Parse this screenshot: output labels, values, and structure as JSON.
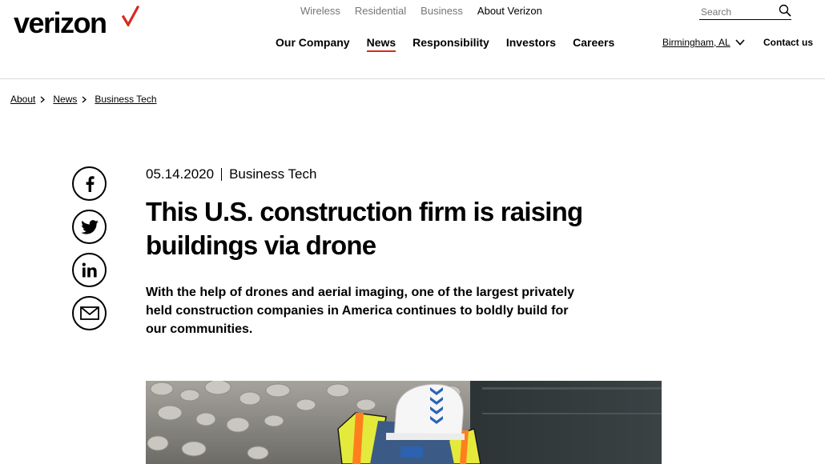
{
  "brand": {
    "logo_text": "verizon",
    "accent_color": "#d52b1e"
  },
  "utility_nav": [
    {
      "label": "Wireless"
    },
    {
      "label": "Residential"
    },
    {
      "label": "Business"
    },
    {
      "label": "About Verizon"
    }
  ],
  "search": {
    "placeholder": "Search",
    "icon": "search-icon"
  },
  "main_nav": [
    {
      "label": "Our Company"
    },
    {
      "label": "News"
    },
    {
      "label": "Responsibility"
    },
    {
      "label": "Investors"
    },
    {
      "label": "Careers"
    }
  ],
  "location": {
    "label": "Birmingham, AL",
    "icon": "chevron-down-icon"
  },
  "contact": {
    "label": "Contact us"
  },
  "breadcrumb": [
    {
      "label": "About"
    },
    {
      "label": "News"
    },
    {
      "label": "Business Tech"
    }
  ],
  "social": [
    "facebook-icon",
    "twitter-icon",
    "linkedin-icon",
    "email-icon"
  ],
  "article": {
    "date": "05.14.2020",
    "category": "Business Tech",
    "title": "This U.S. construction firm is raising buildings via drone",
    "dek": "With the help of drones and aerial imaging, one of the largest privately held construction companies in America continues to boldly build for our communities."
  }
}
